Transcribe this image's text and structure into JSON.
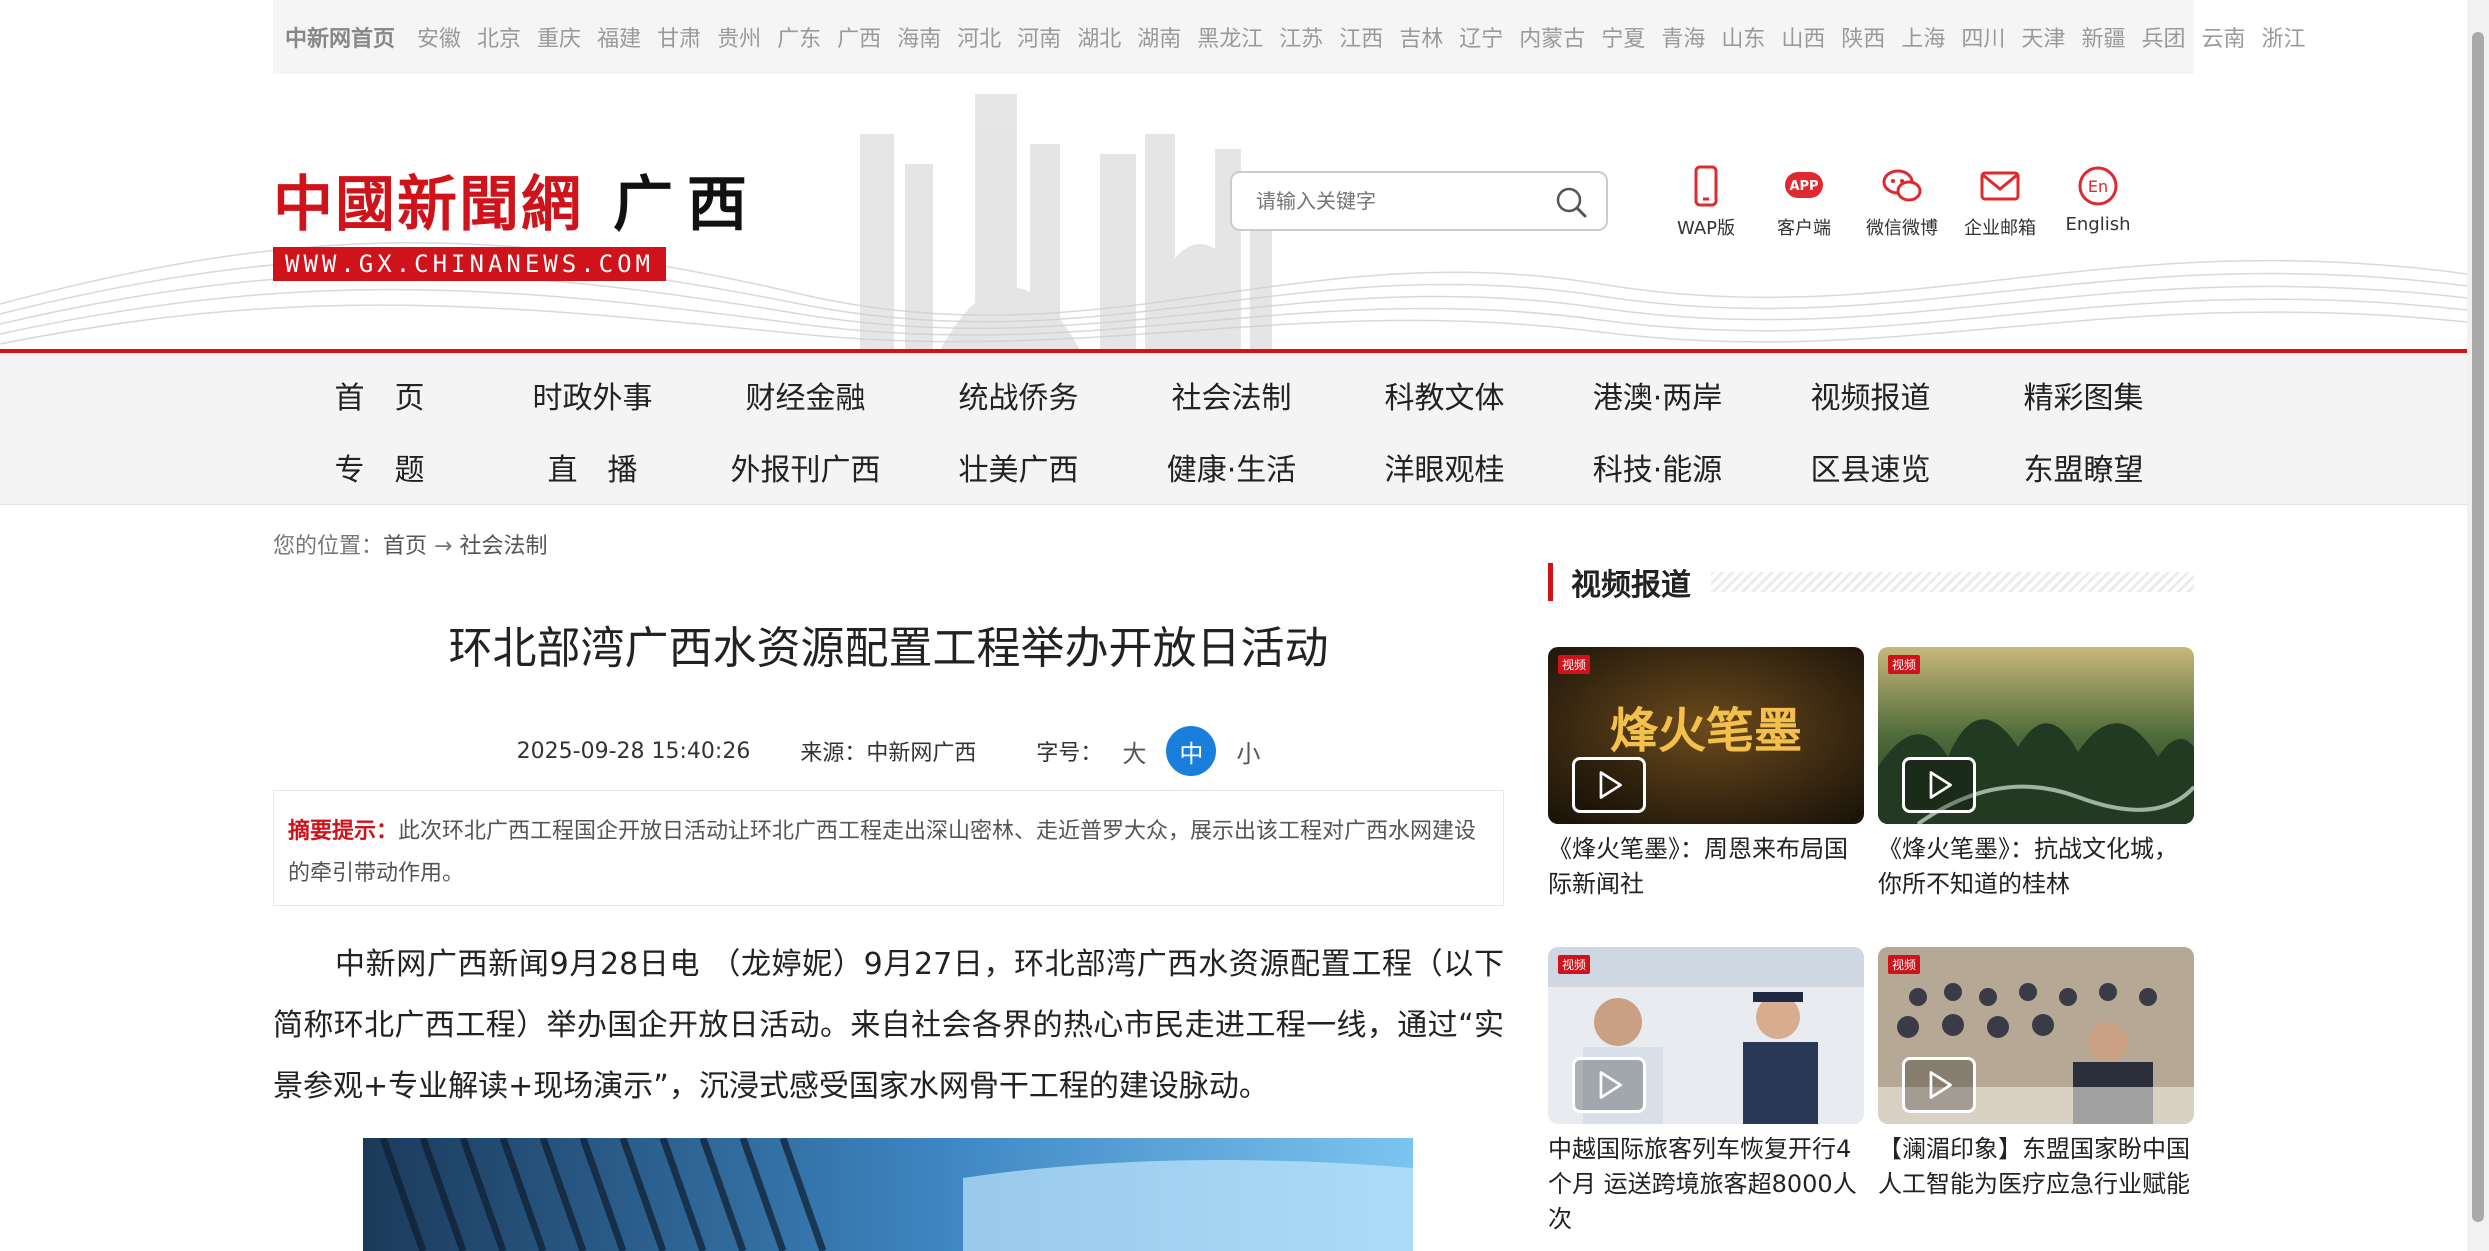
{
  "topbar": {
    "home": "中新网首页",
    "provinces": [
      "安徽",
      "北京",
      "重庆",
      "福建",
      "甘肃",
      "贵州",
      "广东",
      "广西",
      "海南",
      "河北",
      "河南",
      "湖北",
      "湖南",
      "黑龙江",
      "江苏",
      "江西",
      "吉林",
      "辽宁",
      "内蒙古",
      "宁夏",
      "青海",
      "山东",
      "山西",
      "陕西",
      "上海",
      "四川",
      "天津",
      "新疆",
      "兵团",
      "云南",
      "浙江"
    ]
  },
  "header": {
    "logo_cn": "中國新聞網",
    "logo_region": "广西",
    "logo_url": "WWW.GX.CHINANEWS.COM",
    "search_placeholder": "请输入关键字",
    "tools": [
      {
        "icon": "phone-icon",
        "label": "WAP版"
      },
      {
        "icon": "app-icon",
        "label": "客户端"
      },
      {
        "icon": "wechat-weibo-icon",
        "label": "微信微博"
      },
      {
        "icon": "mail-icon",
        "label": "企业邮箱"
      },
      {
        "icon": "english-icon",
        "label": "English"
      }
    ],
    "accent_color": "#d0121b"
  },
  "nav": {
    "row1": [
      "首　页",
      "时政外事",
      "财经金融",
      "统战侨务",
      "社会法制",
      "科教文体",
      "港澳·两岸",
      "视频报道",
      "精彩图集"
    ],
    "row2": [
      "专　题",
      "直　播",
      "外报刊广西",
      "壮美广西",
      "健康·生活",
      "洋眼观桂",
      "科技·能源",
      "区县速览",
      "东盟瞭望"
    ]
  },
  "breadcrumb": {
    "prefix": "您的位置：",
    "home": "首页",
    "arrow": "→",
    "section": "社会法制"
  },
  "article": {
    "title": "环北部湾广西水资源配置工程举办开放日活动",
    "datetime": "2025-09-28 15:40:26",
    "source": "来源：中新网广西",
    "font_label": "字号：",
    "font_large": "大",
    "font_medium": "中",
    "font_small": "小",
    "summary_label": "摘要提示：",
    "summary_text": "此次环北广西工程国企开放日活动让环北广西工程走出深山密林、走近普罗大众，展示出该工程对广西水网建设的牵引带动作用。",
    "paragraph": "中新网广西新闻9月28日电 （龙婷妮）9月27日，环北部湾广西水资源配置工程（以下简称环北广西工程）举办国企开放日活动。来自社会各界的热心市民走进工程一线，通过“实景参观+专业解读+现场演示”，沉浸式感受国家水网骨干工程的建设脉动。"
  },
  "sidebar": {
    "title": "视频报道",
    "videos": [
      {
        "caption": "《烽火笔墨》：周恩来布局国际新闻社",
        "thumb_text": "烽火笔墨"
      },
      {
        "caption": "《烽火笔墨》：抗战文化城，你所不知道的桂林"
      },
      {
        "caption": "中越国际旅客列车恢复开行4个月 运送跨境旅客超8000人次"
      },
      {
        "caption": "【澜湄印象】东盟国家盼中国人工智能为医疗应急行业赋能"
      }
    ]
  }
}
